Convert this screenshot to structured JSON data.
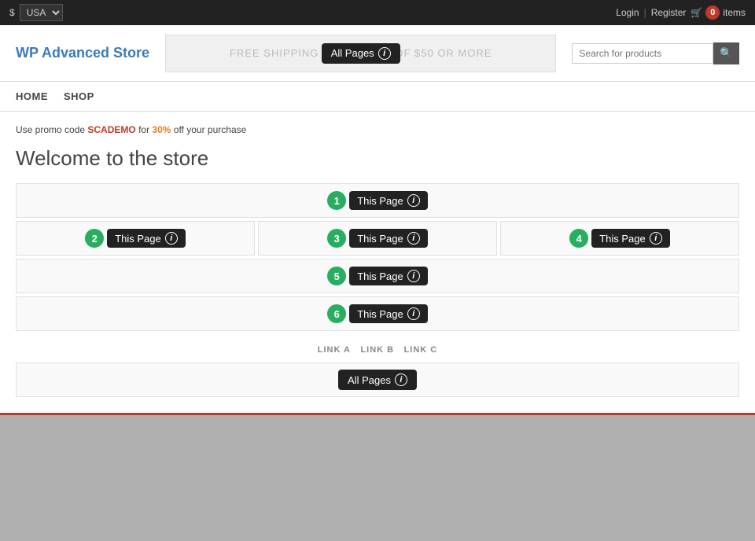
{
  "topbar": {
    "currency_symbol": "$",
    "currency_value": "USA",
    "login_label": "Login",
    "register_label": "Register",
    "divider": "|",
    "cart_count": "0",
    "items_label": "items"
  },
  "header": {
    "logo_text": "WP Advanced Store",
    "banner_bg_text": "FREE SHIPPING ON ORDERS OF $50 OR MORE",
    "all_pages_label": "All Pages",
    "info_icon": "i",
    "search_placeholder": "Search for products"
  },
  "nav": {
    "items": [
      {
        "label": "HOME",
        "href": "#"
      },
      {
        "label": "SHOP",
        "href": "#"
      }
    ]
  },
  "promo": {
    "prefix": "Use promo code",
    "code": "SCADEMO",
    "middle": "for",
    "pct": "30%",
    "suffix": "off your purchase"
  },
  "page_title": "Welcome to the store",
  "widgets": [
    {
      "id": "1",
      "label": "This Page",
      "scope": "this_page"
    },
    {
      "id": "2",
      "label": "This Page",
      "scope": "this_page"
    },
    {
      "id": "3",
      "label": "This Page",
      "scope": "this_page"
    },
    {
      "id": "4",
      "label": "This Page",
      "scope": "this_page"
    },
    {
      "id": "5",
      "label": "This Page",
      "scope": "this_page"
    },
    {
      "id": "6",
      "label": "This Page",
      "scope": "this_page"
    }
  ],
  "links": [
    {
      "label": "LINK A",
      "href": "#"
    },
    {
      "label": "LINK B",
      "href": "#"
    },
    {
      "label": "LINK C",
      "href": "#"
    }
  ],
  "bottom_bar": {
    "label": "All Pages",
    "info_icon": "i"
  }
}
